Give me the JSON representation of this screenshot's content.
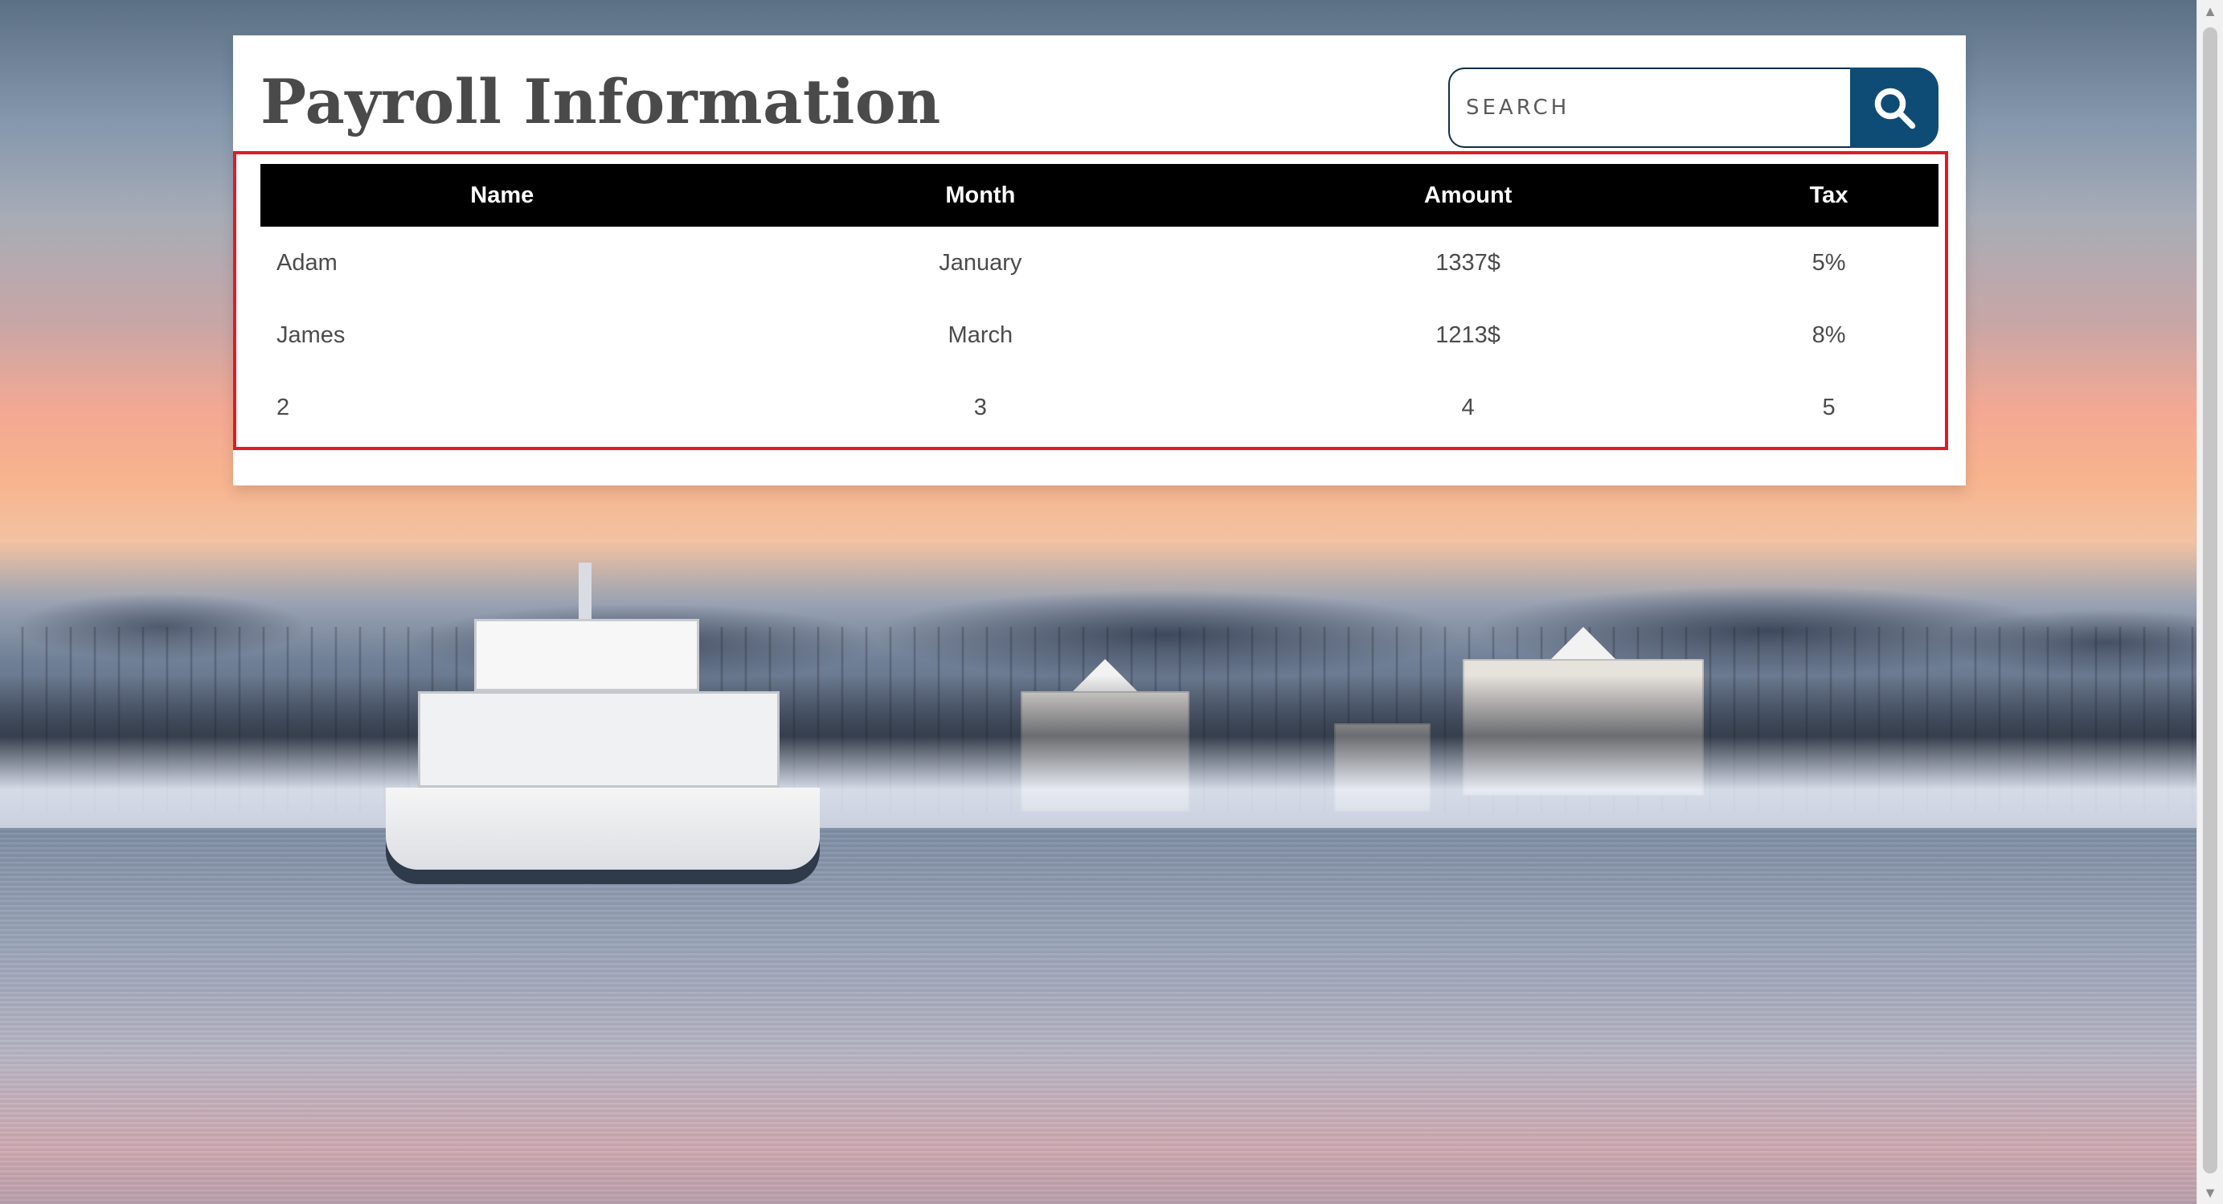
{
  "page": {
    "title": "Payroll Information"
  },
  "search": {
    "placeholder": "SEARCH",
    "button_icon": "search-icon"
  },
  "table": {
    "columns": [
      "Name",
      "Month",
      "Amount",
      "Tax"
    ],
    "rows": [
      [
        "Adam",
        "January",
        "1337$",
        "5%"
      ],
      [
        "James",
        "March",
        "1213$",
        "8%"
      ],
      [
        "2",
        "3",
        "4",
        "5"
      ]
    ]
  },
  "colors": {
    "header_bg": "#000000",
    "header_text": "#ffffff",
    "accent": "#0f4c75",
    "highlight_border": "#e01b24"
  }
}
